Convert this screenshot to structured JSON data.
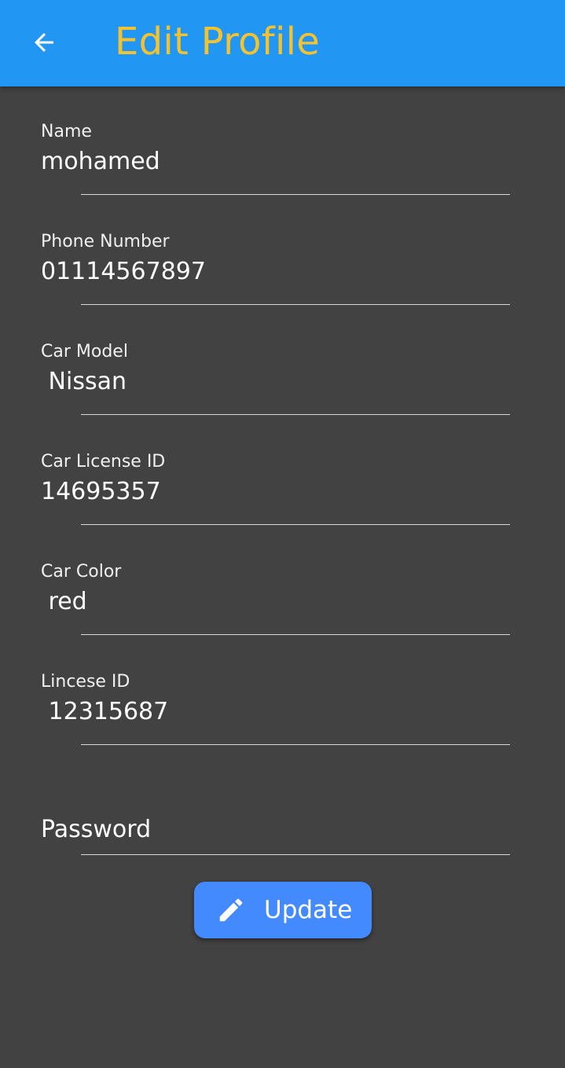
{
  "app_bar": {
    "title": "Edit Profile",
    "back_icon": "arrow-back-icon",
    "background_color": "#2196f3",
    "title_color": "#f2c230"
  },
  "form": {
    "fields": [
      {
        "label": "Name",
        "value": "mohamed"
      },
      {
        "label": "Phone Number",
        "value": "01114567897"
      },
      {
        "label": "Car Model",
        "value": " Nissan"
      },
      {
        "label": "Car License ID",
        "value": "14695357"
      },
      {
        "label": "Car Color",
        "value": " red"
      },
      {
        "label": "Lincese ID",
        "value": " 12315687"
      }
    ],
    "password": {
      "placeholder": "Password"
    }
  },
  "update_button": {
    "label": "Update",
    "icon": "pencil-icon",
    "color": "#448aff"
  },
  "page_background": "#424242"
}
